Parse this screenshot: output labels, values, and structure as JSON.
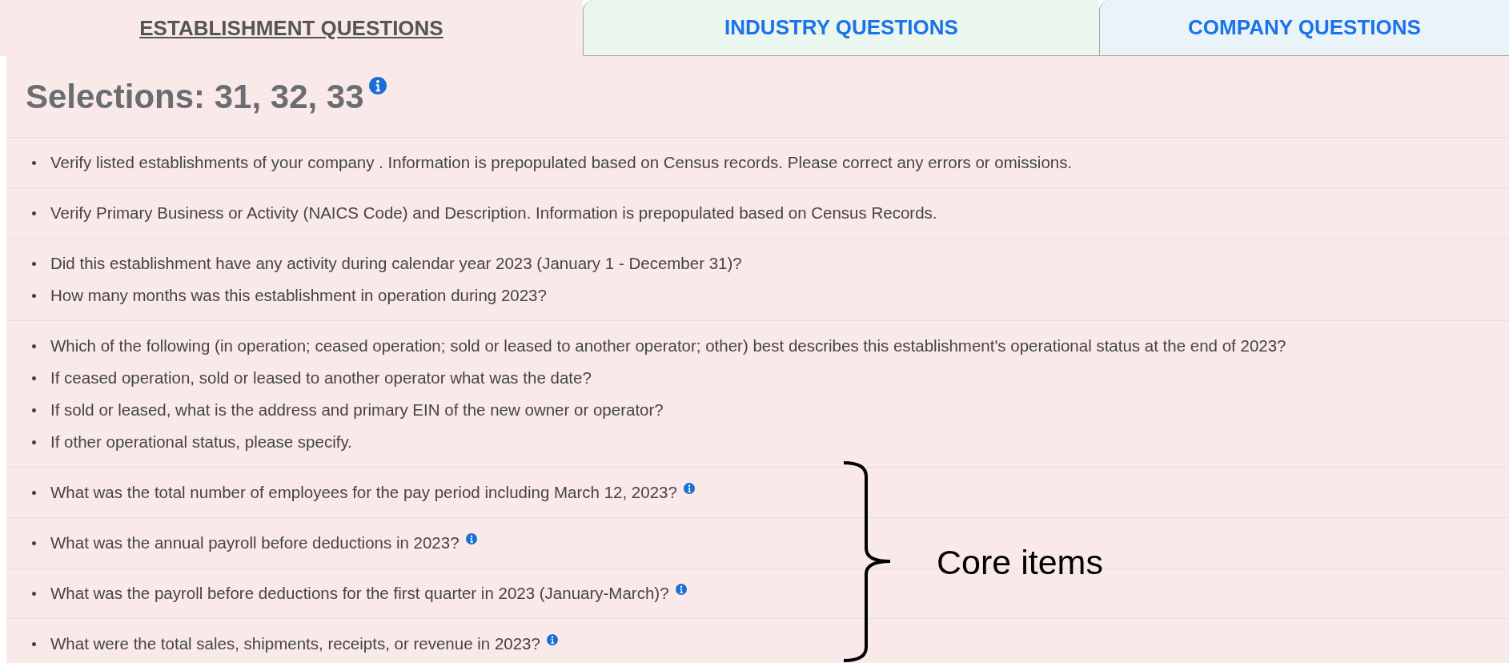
{
  "tabs": [
    {
      "label": "ESTABLISHMENT QUESTIONS",
      "selected": true,
      "color": "#f9eae9"
    },
    {
      "label": "INDUSTRY QUESTIONS",
      "selected": false,
      "color": "#eaf6ee"
    },
    {
      "label": "COMPANY QUESTIONS",
      "selected": false,
      "color": "#eaf3f8"
    }
  ],
  "heading": {
    "text": "Selections: 31, 32, 33",
    "info": true
  },
  "groups": [
    {
      "items": [
        {
          "text": "Verify listed establishments of your company . Information is prepopulated based on Census records. Please correct any errors or omissions.",
          "info": false
        }
      ]
    },
    {
      "items": [
        {
          "text": "Verify Primary Business or Activity (NAICS Code) and Description. Information is prepopulated based on Census Records.",
          "info": false
        }
      ]
    },
    {
      "items": [
        {
          "text": "Did this establishment have any activity during calendar year 2023 (January 1 - December 31)?",
          "info": false
        },
        {
          "text": "How many months was this establishment in operation during 2023?",
          "info": false
        }
      ]
    },
    {
      "items": [
        {
          "text": "Which of the following (in operation; ceased operation; sold or leased to another operator; other) best describes this establishment's operational status at the end of 2023?",
          "info": false
        },
        {
          "text": "If ceased operation, sold or leased to another operator what was the date?",
          "info": false
        },
        {
          "text": "If sold or leased, what is the address and primary EIN of the new owner or operator?",
          "info": false
        },
        {
          "text": "If other operational status, please specify.",
          "info": false
        }
      ]
    },
    {
      "items": [
        {
          "text": "What was the total number of employees for the pay period including March 12, 2023?",
          "info": true
        }
      ]
    },
    {
      "items": [
        {
          "text": "What was the annual payroll before deductions in 2023?",
          "info": true
        }
      ]
    },
    {
      "items": [
        {
          "text": "What was the payroll before deductions for the first quarter in 2023 (January-March)?",
          "info": true
        }
      ]
    },
    {
      "items": [
        {
          "text": "What were the total sales, shipments, receipts, or revenue in 2023?",
          "info": true
        }
      ]
    }
  ],
  "annotation": {
    "label": "Core items"
  }
}
